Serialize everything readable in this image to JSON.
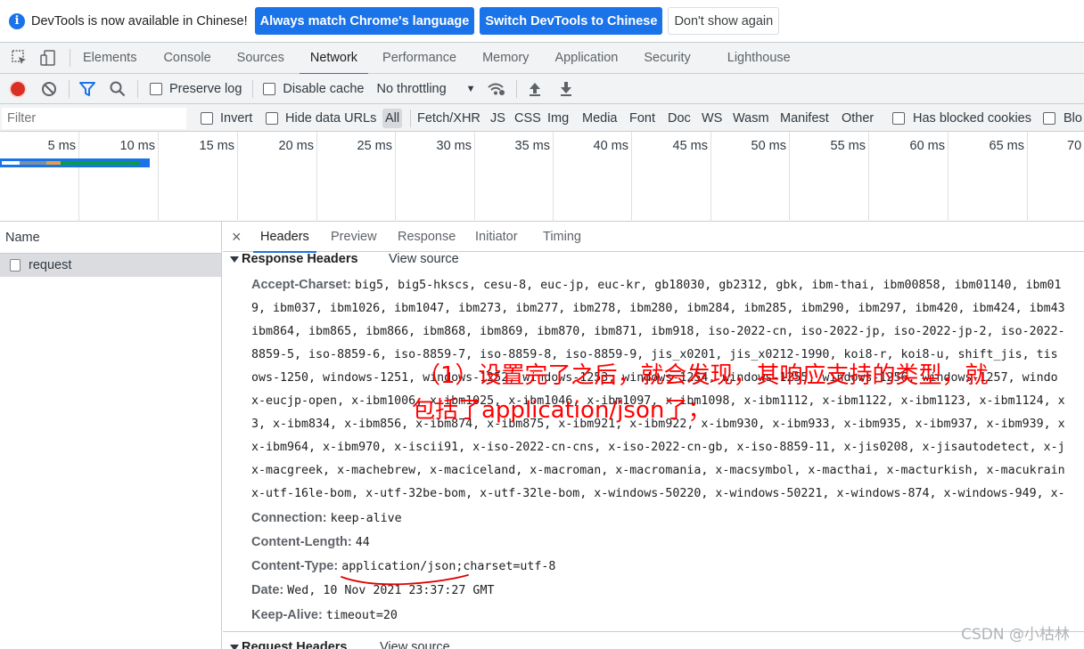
{
  "infobar": {
    "message": "DevTools is now available in Chinese!",
    "btn_match": "Always match Chrome's language",
    "btn_switch": "Switch DevTools to Chinese",
    "btn_dismiss": "Don't show again"
  },
  "main_tabs": [
    "Elements",
    "Console",
    "Sources",
    "Network",
    "Performance",
    "Memory",
    "Application",
    "Security",
    "Lighthouse"
  ],
  "active_main_tab": "Network",
  "toolbar": {
    "preserve_log": "Preserve log",
    "disable_cache": "Disable cache",
    "throttling": "No throttling"
  },
  "filter": {
    "placeholder": "Filter",
    "invert": "Invert",
    "hide_data_urls": "Hide data URLs",
    "types": [
      "All",
      "Fetch/XHR",
      "JS",
      "CSS",
      "Img",
      "Media",
      "Font",
      "Doc",
      "WS",
      "Wasm",
      "Manifest",
      "Other"
    ],
    "has_blocked_cookies": "Has blocked cookies",
    "blocked_requests_cut": "Blo"
  },
  "timeline": {
    "ticks": [
      "5 ms",
      "10 ms",
      "15 ms",
      "20 ms",
      "25 ms",
      "30 ms",
      "35 ms",
      "40 ms",
      "45 ms",
      "50 ms",
      "55 ms",
      "60 ms",
      "65 ms",
      "70"
    ],
    "bar_colors": {
      "queue": "#ffffff",
      "stalled": "#7b8fa6",
      "connect": "#e8a037",
      "waiting": "#0a9e43",
      "download": "#1a73e8"
    }
  },
  "requests": {
    "column": "Name",
    "items": [
      "request"
    ]
  },
  "detail_tabs": [
    "Headers",
    "Preview",
    "Response",
    "Initiator",
    "Timing"
  ],
  "active_detail_tab": "Headers",
  "response_headers": {
    "title": "Response Headers",
    "view_source": "View source",
    "accept_charset_key": "Accept-Charset:",
    "accept_charset_lines": [
      "big5, big5-hkscs, cesu-8, euc-jp, euc-kr, gb18030, gb2312, gbk, ibm-thai, ibm00858, ibm01140, ibm01",
      "9, ibm037, ibm1026, ibm1047, ibm273, ibm277, ibm278, ibm280, ibm284, ibm285, ibm290, ibm297, ibm420, ibm424, ibm43",
      "ibm864, ibm865, ibm866, ibm868, ibm869, ibm870, ibm871, ibm918, iso-2022-cn, iso-2022-jp, iso-2022-jp-2, iso-2022-",
      "8859-5, iso-8859-6, iso-8859-7, iso-8859-8, iso-8859-9, jis_x0201, jis_x0212-1990, koi8-r, koi8-u, shift_jis, tis",
      "ows-1250, windows-1251, windows-1252, windows-1253, windows-1254, windows-1255, windows-1256, windows-1257, windo",
      "x-eucjp-open, x-ibm1006, x-ibm1025, x-ibm1046, x-ibm1097, x-ibm1098, x-ibm1112, x-ibm1122, x-ibm1123, x-ibm1124, x",
      "3, x-ibm834, x-ibm856, x-ibm874, x-ibm875, x-ibm921, x-ibm922, x-ibm930, x-ibm933, x-ibm935, x-ibm937, x-ibm939, x",
      "x-ibm964, x-ibm970, x-iscii91, x-iso-2022-cn-cns, x-iso-2022-cn-gb, x-iso-8859-11, x-jis0208, x-jisautodetect, x-j",
      "x-macgreek, x-machebrew, x-maciceland, x-macroman, x-macromania, x-macsymbol, x-macthai, x-macturkish, x-macukrain",
      "x-utf-16le-bom, x-utf-32be-bom, x-utf-32le-bom, x-windows-50220, x-windows-50221, x-windows-874, x-windows-949, x-"
    ],
    "connection_key": "Connection:",
    "connection_val": "keep-alive",
    "content_length_key": "Content-Length:",
    "content_length_val": "44",
    "content_type_key": "Content-Type:",
    "content_type_val": "application/json;charset=utf-8",
    "date_key": "Date:",
    "date_val": "Wed, 10 Nov 2021 23:37:27 GMT",
    "keep_alive_key": "Keep-Alive:",
    "keep_alive_val": "timeout=20"
  },
  "request_headers": {
    "title": "Request Headers",
    "view_source": "View source"
  },
  "annotation": {
    "line1": "（1）设置完了之后，就会发现，其响应支持的类型，就",
    "line2": "包括了application/json了；",
    "color": "#ff0000"
  },
  "watermark": "CSDN @小枯林"
}
